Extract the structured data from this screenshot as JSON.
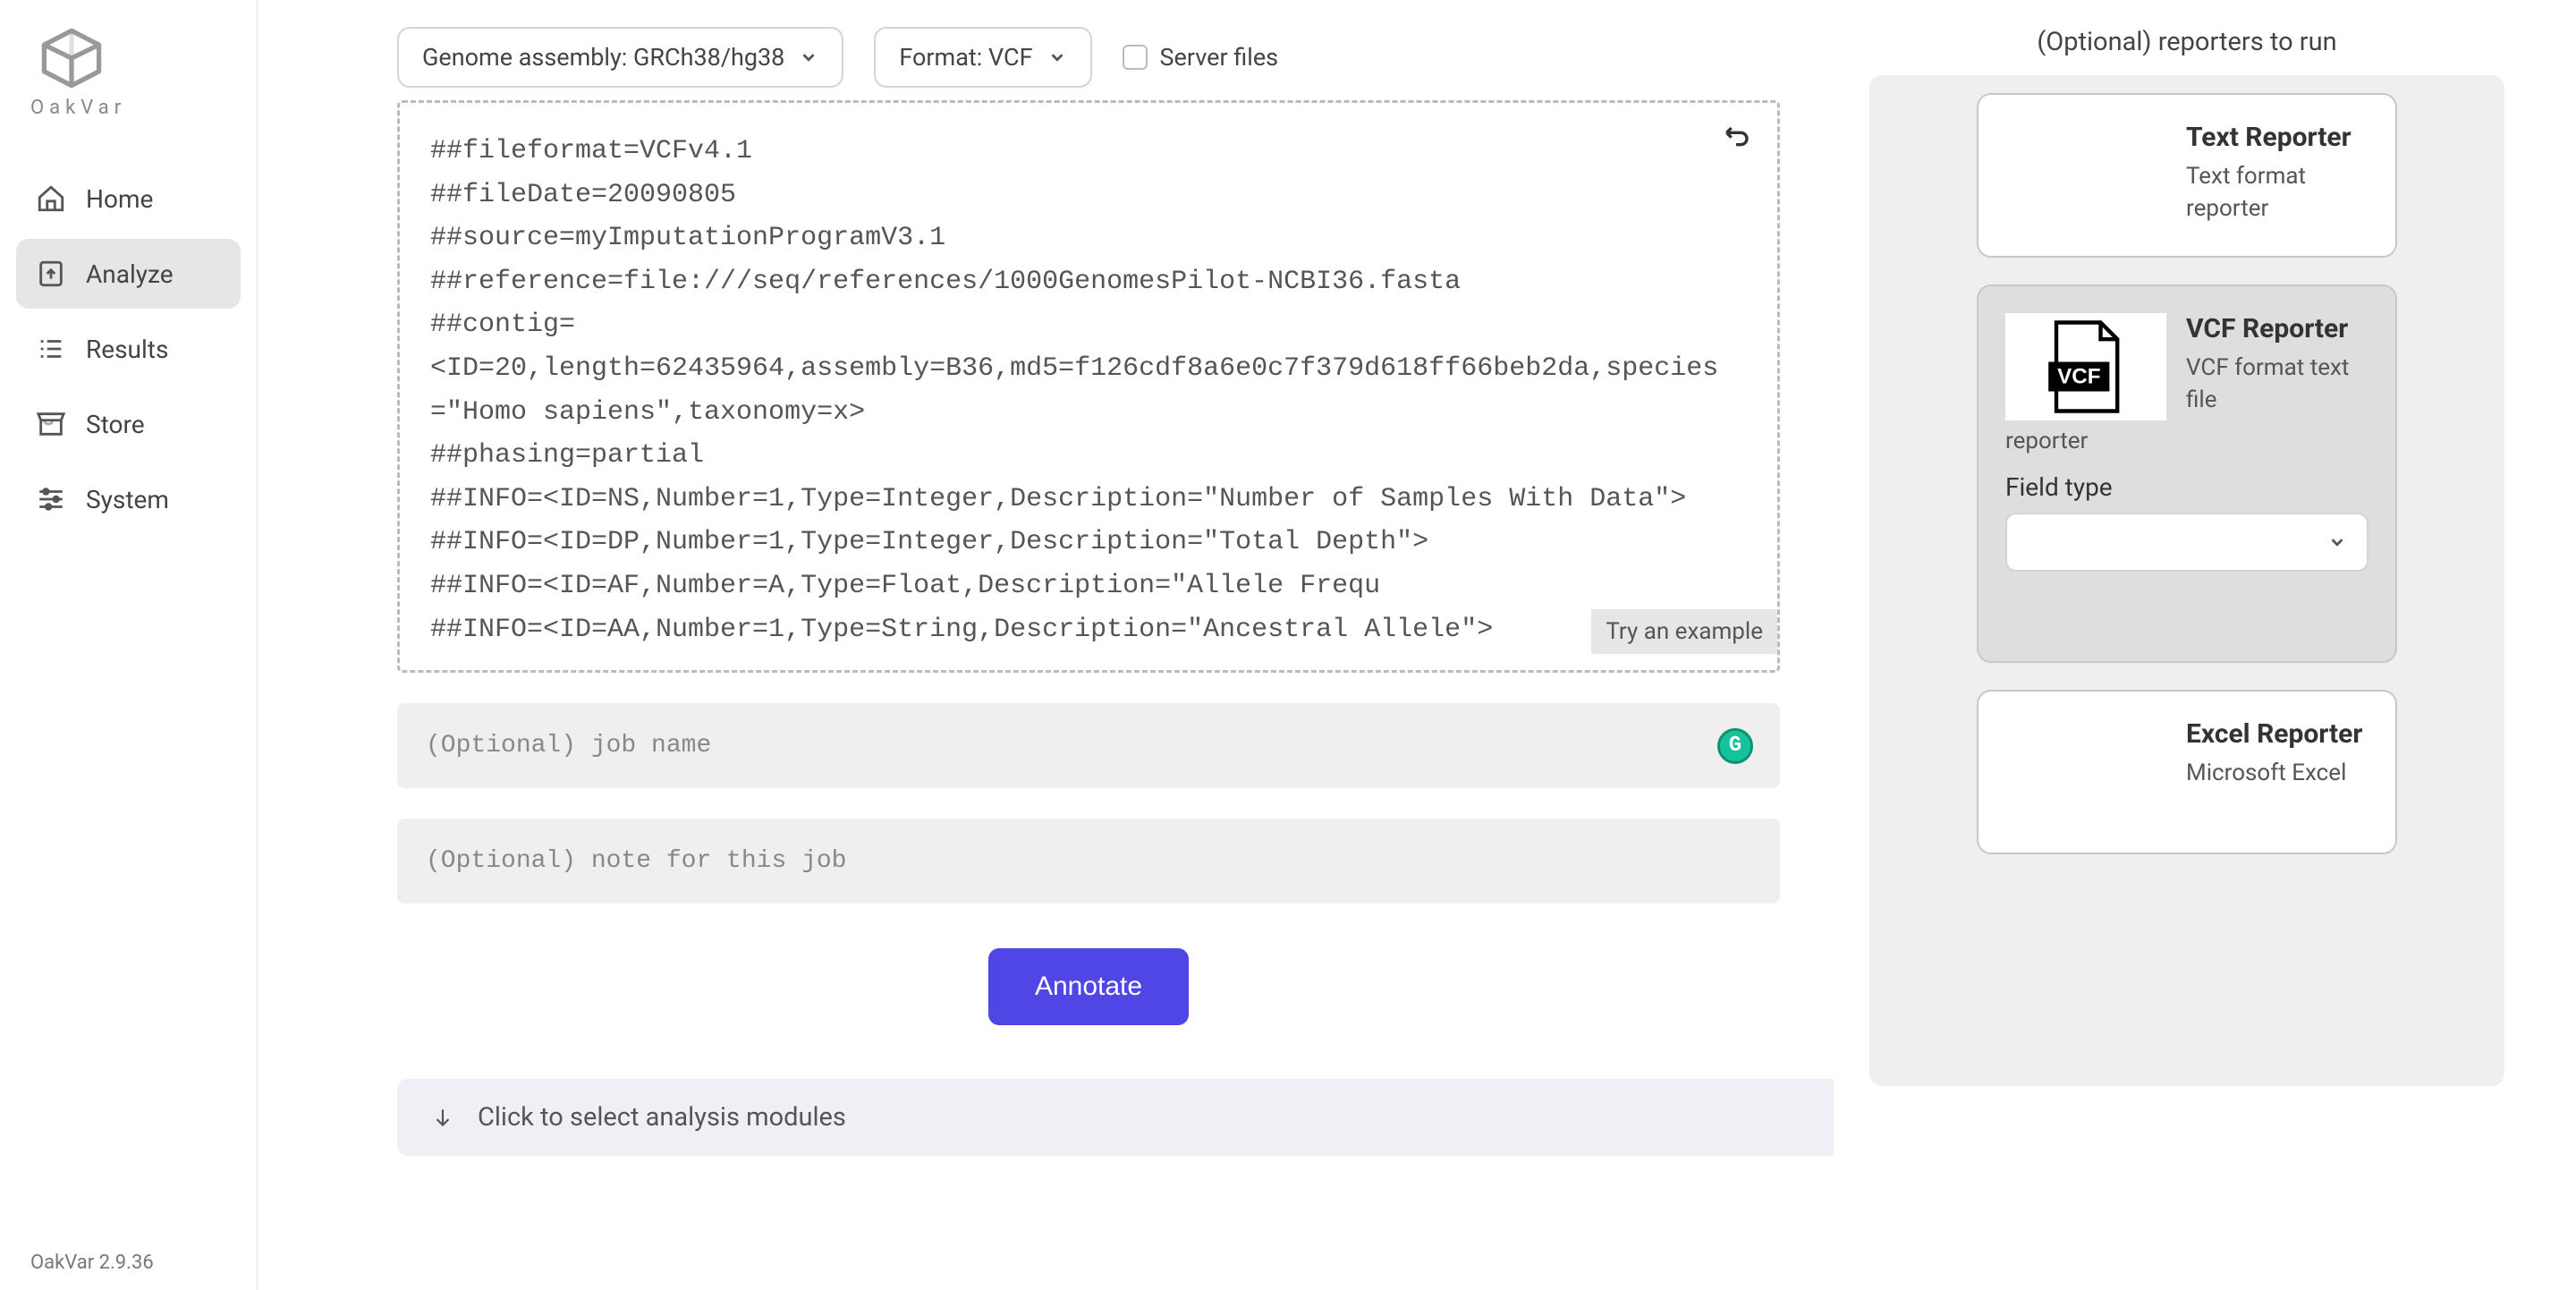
{
  "sidebar": {
    "brand": "OakVar",
    "items": [
      {
        "label": "Home"
      },
      {
        "label": "Analyze"
      },
      {
        "label": "Results"
      },
      {
        "label": "Store"
      },
      {
        "label": "System"
      }
    ],
    "version": "OakVar 2.9.36"
  },
  "controls": {
    "assembly_label": "Genome assembly: GRCh38/hg38",
    "format_label": "Format: VCF",
    "server_files_label": "Server files"
  },
  "vcf_content": "##fileformat=VCFv4.1\n##fileDate=20090805\n##source=myImputationProgramV3.1\n##reference=file:///seq/references/1000GenomesPilot-NCBI36.fasta\n##contig=\n<ID=20,length=62435964,assembly=B36,md5=f126cdf8a6e0c7f379d618ff66beb2da,species=\"Homo sapiens\",taxonomy=x>\n##phasing=partial\n##INFO=<ID=NS,Number=1,Type=Integer,Description=\"Number of Samples With Data\">\n##INFO=<ID=DP,Number=1,Type=Integer,Description=\"Total Depth\">\n##INFO=<ID=AF,Number=A,Type=Float,Description=\"Allele Frequ\n##INFO=<ID=AA,Number=1,Type=String,Description=\"Ancestral Allele\">",
  "try_example": "Try an example",
  "job_name_placeholder": "(Optional) job name",
  "job_note_placeholder": "(Optional) note for this job",
  "annotate_label": "Annotate",
  "modules_label": "Click to select analysis modules",
  "reporters": {
    "header": "(Optional) reporters to run",
    "cards": [
      {
        "title": "Text Reporter",
        "desc": "Text format reporter"
      },
      {
        "title": "VCF Reporter",
        "desc": "VCF format text file",
        "desc_cont": "reporter",
        "field_label": "Field type",
        "icon_text": "VCF"
      },
      {
        "title": "Excel Reporter",
        "desc": "Microsoft Excel"
      }
    ]
  }
}
